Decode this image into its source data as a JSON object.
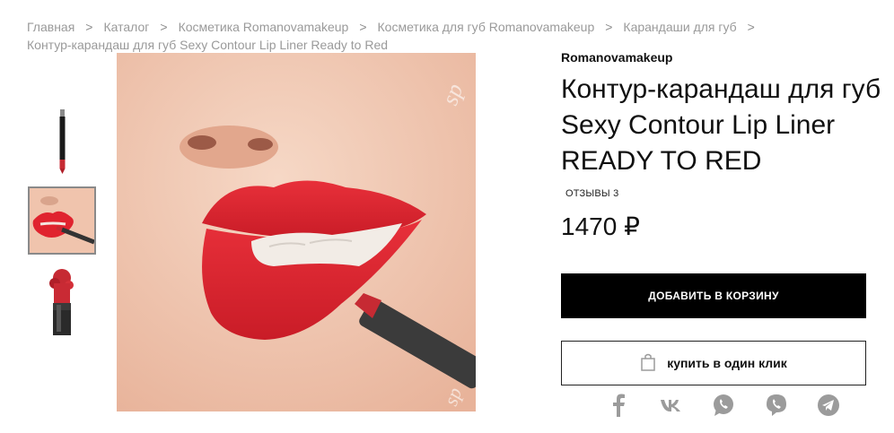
{
  "breadcrumb": {
    "items": [
      "Главная",
      "Каталог",
      "Косметика Romanovamakeup",
      "Косметика для губ Romanovamakeup",
      "Карандаши для губ"
    ],
    "current": "Контур-карандаш для губ Sexy Contour Lip Liner Ready to Red"
  },
  "product": {
    "brand": "Romanovamakeup",
    "title_line1": "Контур-карандаш для губ",
    "title_line2": "Sexy Contour Lip Liner",
    "title_line3": "READY TO RED",
    "reviews": "ОТЗЫВЫ 3",
    "price": "1470 ₽"
  },
  "actions": {
    "add_to_cart": "ДОБАВИТЬ В КОРЗИНУ",
    "buy_one_click": "купить в один клик"
  },
  "share": [
    "facebook-icon",
    "vk-icon",
    "whatsapp-icon",
    "viber-icon",
    "telegram-icon"
  ],
  "colors": {
    "accent": "#000000",
    "lip": "#e0232e",
    "share_icon": "#9b9b9b"
  }
}
